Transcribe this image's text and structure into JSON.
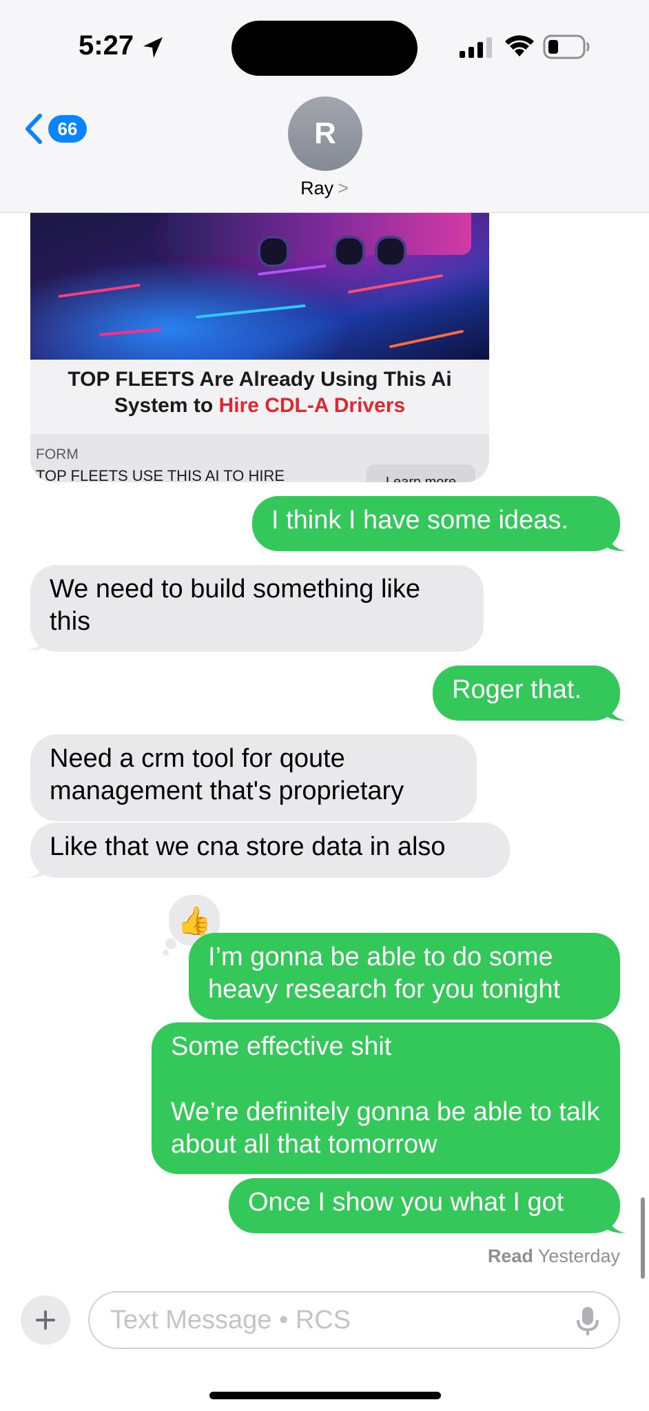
{
  "status_bar": {
    "time": "5:27"
  },
  "header": {
    "back_count": "66",
    "avatar_initial": "R",
    "contact_name": "Ray",
    "contact_chevron": ">"
  },
  "link_preview": {
    "headline_part1": "TOP FLEETS Are Already Using This Ai System to ",
    "headline_highlight": "Hire CDL-A Drivers",
    "form_label": "FORM",
    "form_title": "TOP FLEETS USE THIS AI TO HIRE",
    "button_label": "Learn more"
  },
  "messages": [
    {
      "from": "me",
      "text": "I think I have some ideas."
    },
    {
      "from": "them",
      "text": "We need to build something like this"
    },
    {
      "from": "me",
      "text": "Roger that."
    },
    {
      "from": "them",
      "text": "Need a crm tool for qoute management that's proprietary"
    },
    {
      "from": "them",
      "text": "Like that we cna store data in also"
    },
    {
      "from": "me",
      "text": "I’m gonna be able to do some heavy research for you tonight",
      "reaction": "👍"
    },
    {
      "from": "me",
      "text": "Some effective shit",
      "text2": "We’re definitely gonna be able to talk about all that tomorrow"
    },
    {
      "from": "me",
      "text": "Once I show you what I got"
    }
  ],
  "read_receipt": {
    "status": "Read",
    "when": "Yesterday"
  },
  "compose": {
    "placeholder": "Text Message • RCS"
  },
  "colors": {
    "sent": "#34c759",
    "received": "#e9e9eb",
    "accent": "#0a84ff",
    "highlight_red": "#e0262f"
  },
  "icons": [
    "location-arrow-icon",
    "cellular-signal-icon",
    "wifi-icon",
    "battery-icon",
    "chevron-left-icon",
    "plus-icon",
    "microphone-icon"
  ]
}
